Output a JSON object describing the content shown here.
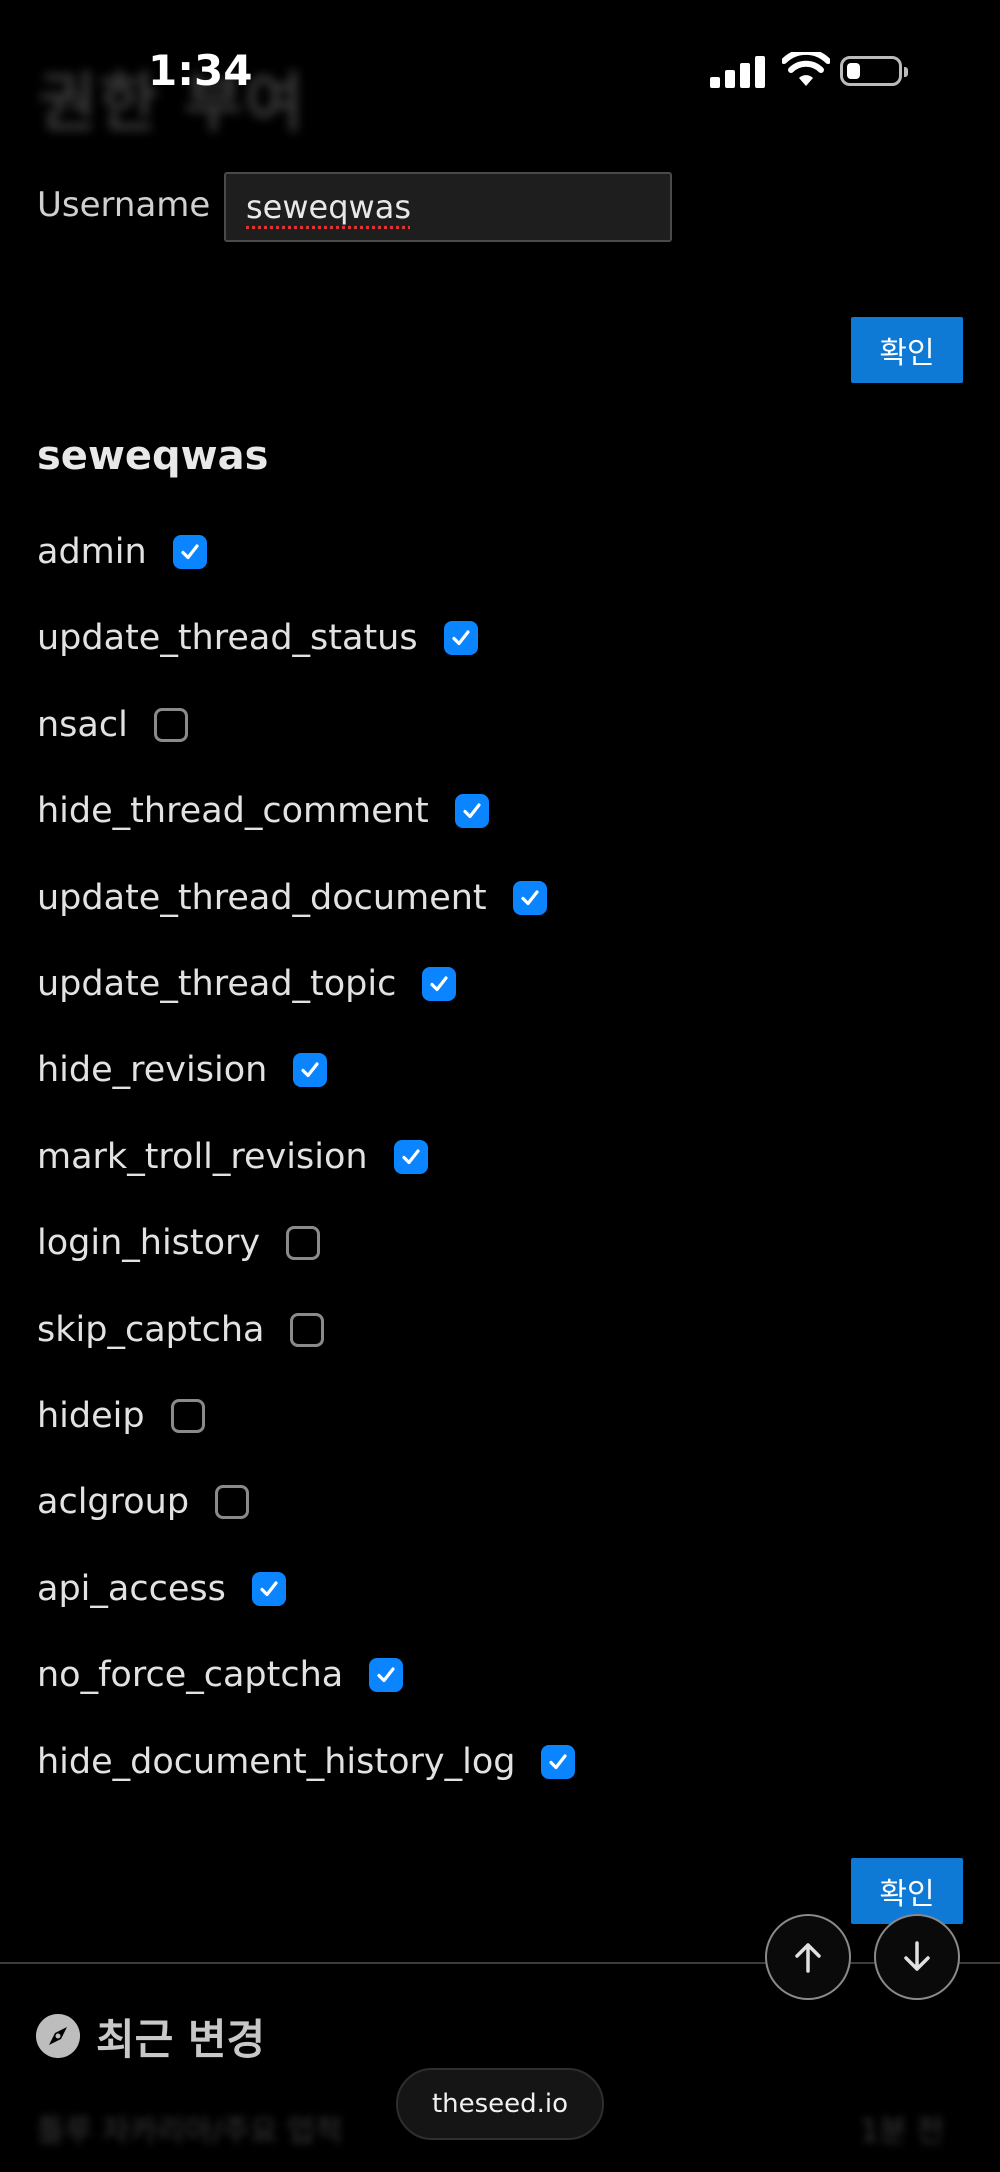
{
  "status_bar": {
    "time": "1:34"
  },
  "page": {
    "heading": "권한 부여",
    "username_label": "Username",
    "username_value": "seweqwas",
    "confirm_label": "확인",
    "user_heading": "seweqwas"
  },
  "permissions": [
    {
      "name": "admin",
      "checked": true
    },
    {
      "name": "update_thread_status",
      "checked": true
    },
    {
      "name": "nsacl",
      "checked": false
    },
    {
      "name": "hide_thread_comment",
      "checked": true
    },
    {
      "name": "update_thread_document",
      "checked": true
    },
    {
      "name": "update_thread_topic",
      "checked": true
    },
    {
      "name": "hide_revision",
      "checked": true
    },
    {
      "name": "mark_troll_revision",
      "checked": true
    },
    {
      "name": "login_history",
      "checked": false
    },
    {
      "name": "skip_captcha",
      "checked": false
    },
    {
      "name": "hideip",
      "checked": false
    },
    {
      "name": "aclgroup",
      "checked": false
    },
    {
      "name": "api_access",
      "checked": true
    },
    {
      "name": "no_force_captcha",
      "checked": true
    },
    {
      "name": "hide_document_history_log",
      "checked": true
    }
  ],
  "recent": {
    "title": "최근 변경",
    "icon": "compass-icon",
    "first_row": "틀루 자카리아/주요 업적",
    "first_row_time": "1분 전"
  },
  "browser": {
    "url": "theseed.io"
  },
  "colors": {
    "accent": "#0e7ad6",
    "checkbox_on": "#0a84ff",
    "background": "#000000"
  }
}
